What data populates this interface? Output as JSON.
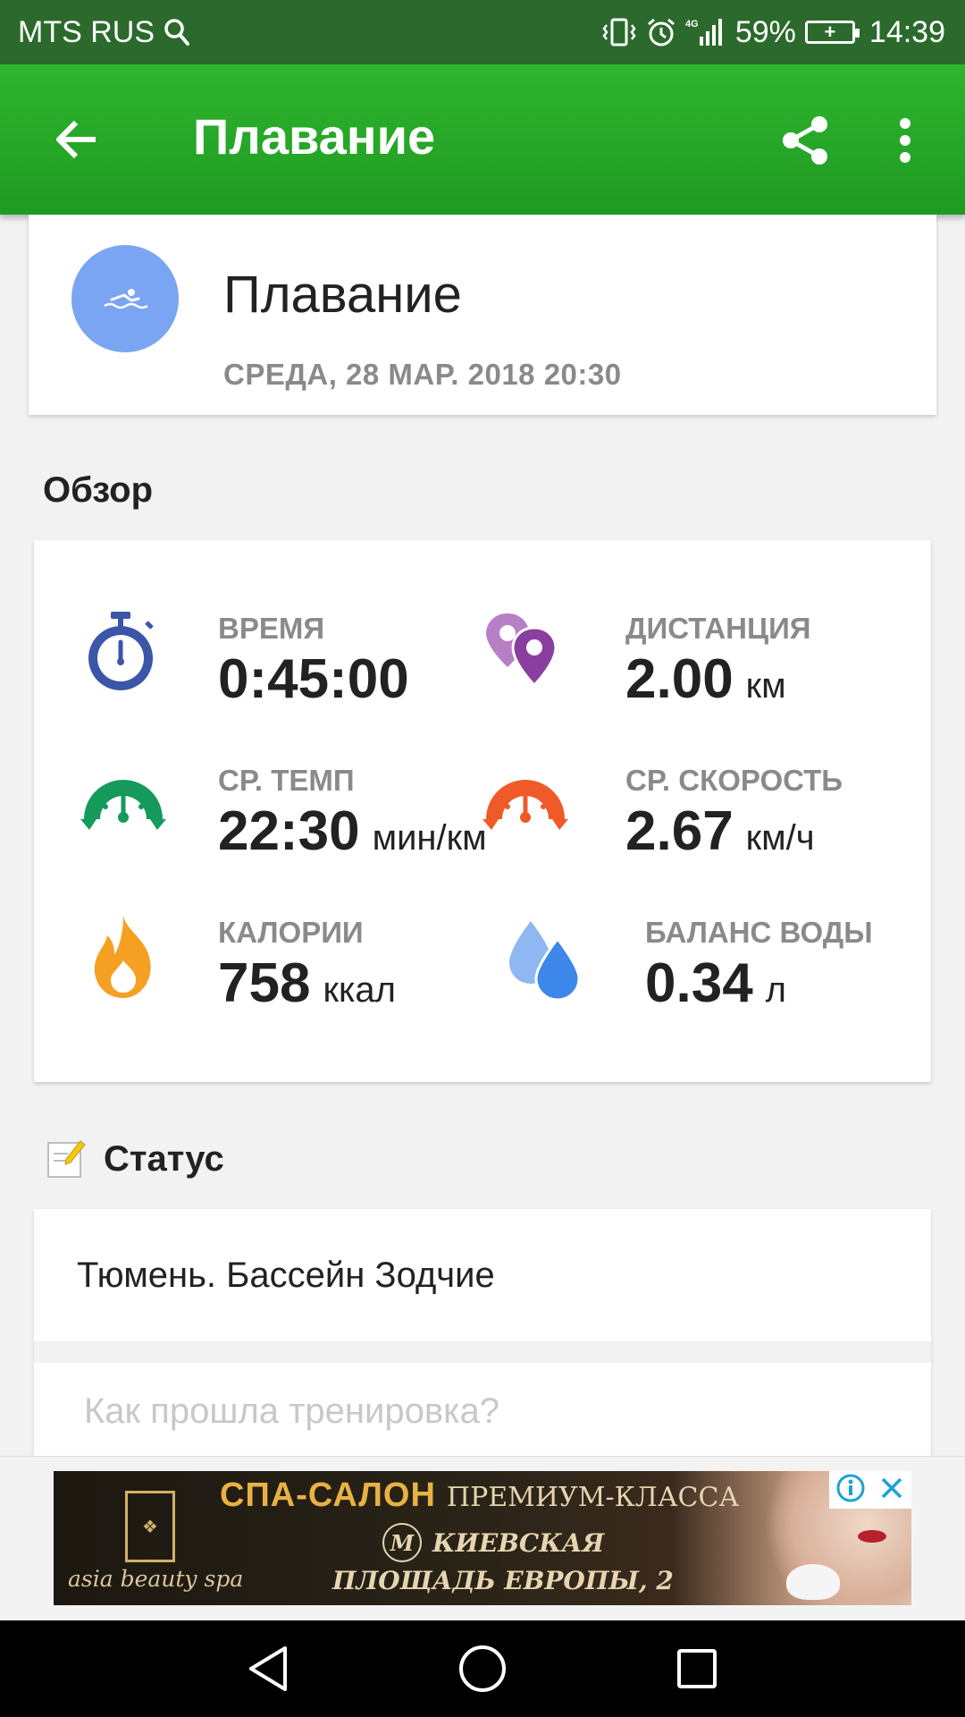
{
  "status_bar": {
    "carrier": "MTS RUS",
    "network": "4G",
    "battery": "59%",
    "time": "14:39"
  },
  "app_bar": {
    "title": "Плавание",
    "icons": [
      "back-arrow-icon",
      "share-icon",
      "more-vert-icon"
    ]
  },
  "activity": {
    "name": "Плавание",
    "datetime": "СРЕДА, 28 МАР. 2018 20:30",
    "avatar_color": "#7aa5f2"
  },
  "overview": {
    "title": "Обзор",
    "metrics": [
      {
        "label": "ВРЕМЯ",
        "value": "0:45:00",
        "unit": "",
        "icon": "stopwatch-icon",
        "color": "#3b56a8"
      },
      {
        "label": "ДИСТАНЦИЯ",
        "value": "2.00",
        "unit": "км",
        "icon": "location-pins-icon",
        "color": "#8a3fa0"
      },
      {
        "label": "СР. ТЕМП",
        "value": "22:30",
        "unit": "мин/км",
        "icon": "pace-gauge-icon",
        "color": "#159a5c"
      },
      {
        "label": "СР. СКОРОСТЬ",
        "value": "2.67",
        "unit": "км/ч",
        "icon": "speed-gauge-icon",
        "color": "#f05a28"
      },
      {
        "label": "КАЛОРИИ",
        "value": "758",
        "unit": "ккал",
        "icon": "flame-icon",
        "color": "#f5a023"
      },
      {
        "label": "БАЛАНС ВОДЫ",
        "value": "0.34",
        "unit": "л",
        "icon": "water-drops-icon",
        "color": "#3d86ea"
      }
    ]
  },
  "status": {
    "title": "Статус",
    "icon": "note-icon",
    "text": "Тюмень. Бассейн Зодчие",
    "comment_placeholder": "Как прошла тренировка?"
  },
  "ad": {
    "brand": "asia beauty spa",
    "line1_a": "СПА-САЛОН",
    "line1_b": "ПРЕМИУМ-КЛАССА",
    "metro_letter": "М",
    "line2": "КИЕВСКАЯ",
    "line3": "ПЛОЩАДЬ ЕВРОПЫ, 2",
    "icons": [
      "ad-info-icon",
      "ad-close-icon"
    ]
  },
  "nav_bar": {
    "icons": [
      "nav-back-icon",
      "nav-home-icon",
      "nav-recents-icon"
    ]
  }
}
